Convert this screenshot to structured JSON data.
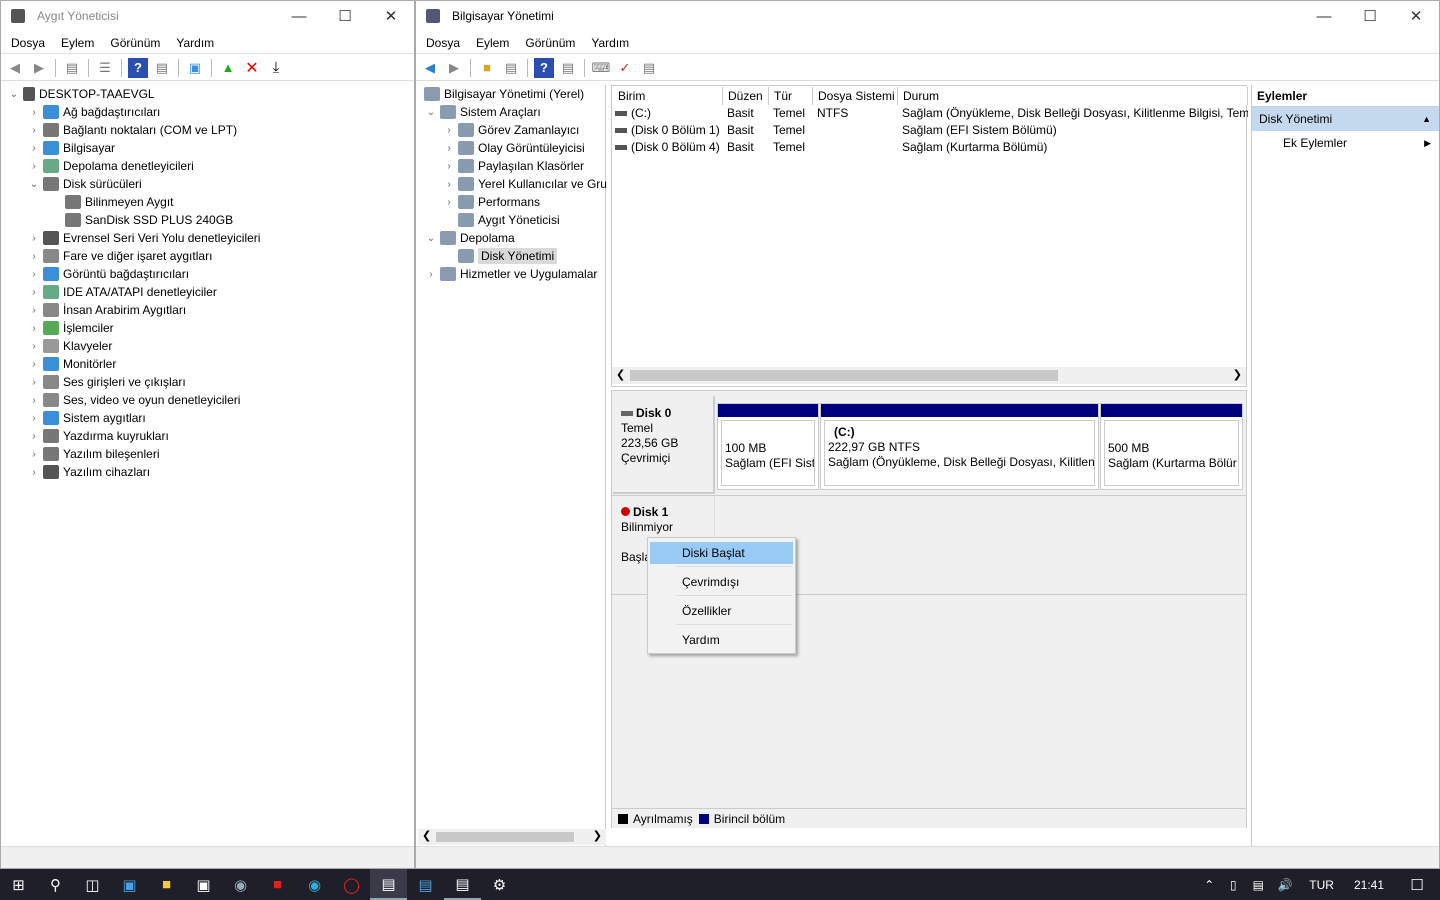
{
  "device_manager": {
    "title": "Aygıt Yöneticisi",
    "menu": [
      "Dosya",
      "Eylem",
      "Görünüm",
      "Yardım"
    ],
    "root": "DESKTOP-TAAEVGL",
    "items": [
      {
        "label": "Ağ bağdaştırıcıları",
        "level": 1,
        "state": "collapsed",
        "icon": "network-adapter-icon",
        "color": "#3a8fd8"
      },
      {
        "label": "Bağlantı noktaları (COM ve LPT)",
        "level": 1,
        "state": "collapsed",
        "icon": "port-icon",
        "color": "#777"
      },
      {
        "label": "Bilgisayar",
        "level": 1,
        "state": "collapsed",
        "icon": "computer-icon",
        "color": "#3a8fd8"
      },
      {
        "label": "Depolama denetleyicileri",
        "level": 1,
        "state": "collapsed",
        "icon": "storage-controller-icon",
        "color": "#6a8"
      },
      {
        "label": "Disk sürücüleri",
        "level": 1,
        "state": "expanded",
        "icon": "disk-drive-icon",
        "color": "#777"
      },
      {
        "label": "Bilinmeyen Aygıt",
        "level": 2,
        "state": "none",
        "icon": "disk-drive-icon",
        "color": "#777"
      },
      {
        "label": "SanDisk SSD PLUS 240GB",
        "level": 2,
        "state": "none",
        "icon": "disk-drive-icon",
        "color": "#777"
      },
      {
        "label": "Evrensel Seri Veri Yolu denetleyicileri",
        "level": 1,
        "state": "collapsed",
        "icon": "usb-icon",
        "color": "#555"
      },
      {
        "label": "Fare ve diğer işaret aygıtları",
        "level": 1,
        "state": "collapsed",
        "icon": "mouse-icon",
        "color": "#888"
      },
      {
        "label": "Görüntü bağdaştırıcıları",
        "level": 1,
        "state": "collapsed",
        "icon": "display-adapter-icon",
        "color": "#3a8fd8"
      },
      {
        "label": "IDE ATA/ATAPI denetleyiciler",
        "level": 1,
        "state": "collapsed",
        "icon": "ide-icon",
        "color": "#6a8"
      },
      {
        "label": "İnsan Arabirim Aygıtları",
        "level": 1,
        "state": "collapsed",
        "icon": "hid-icon",
        "color": "#888"
      },
      {
        "label": "İşlemciler",
        "level": 1,
        "state": "collapsed",
        "icon": "processor-icon",
        "color": "#5a5"
      },
      {
        "label": "Klavyeler",
        "level": 1,
        "state": "collapsed",
        "icon": "keyboard-icon",
        "color": "#999"
      },
      {
        "label": "Monitörler",
        "level": 1,
        "state": "collapsed",
        "icon": "monitor-icon",
        "color": "#3a8fd8"
      },
      {
        "label": "Ses girişleri ve çıkışları",
        "level": 1,
        "state": "collapsed",
        "icon": "speaker-icon",
        "color": "#888"
      },
      {
        "label": "Ses, video ve oyun denetleyicileri",
        "level": 1,
        "state": "collapsed",
        "icon": "sound-icon",
        "color": "#888"
      },
      {
        "label": "Sistem aygıtları",
        "level": 1,
        "state": "collapsed",
        "icon": "system-devices-icon",
        "color": "#3a8fd8"
      },
      {
        "label": "Yazdırma kuyrukları",
        "level": 1,
        "state": "collapsed",
        "icon": "printer-icon",
        "color": "#777"
      },
      {
        "label": "Yazılım bileşenleri",
        "level": 1,
        "state": "collapsed",
        "icon": "software-component-icon",
        "color": "#777"
      },
      {
        "label": "Yazılım cihazları",
        "level": 1,
        "state": "collapsed",
        "icon": "software-device-icon",
        "color": "#555"
      }
    ]
  },
  "computer_management": {
    "title": "Bilgisayar Yönetimi",
    "menu": [
      "Dosya",
      "Eylem",
      "Görünüm",
      "Yardım"
    ],
    "tree": [
      {
        "label": "Bilgisayar Yönetimi (Yerel)",
        "level": 0,
        "state": "none",
        "icon": "computer-management-icon"
      },
      {
        "label": "Sistem Araçları",
        "level": 1,
        "state": "expanded",
        "icon": "tools-icon"
      },
      {
        "label": "Görev Zamanlayıcı",
        "level": 2,
        "state": "collapsed",
        "icon": "clock-icon"
      },
      {
        "label": "Olay Görüntüleyicisi",
        "level": 2,
        "state": "collapsed",
        "icon": "event-viewer-icon"
      },
      {
        "label": "Paylaşılan Klasörler",
        "level": 2,
        "state": "collapsed",
        "icon": "shared-folder-icon"
      },
      {
        "label": "Yerel Kullanıcılar ve Gru",
        "level": 2,
        "state": "collapsed",
        "icon": "users-icon"
      },
      {
        "label": "Performans",
        "level": 2,
        "state": "collapsed",
        "icon": "performance-icon"
      },
      {
        "label": "Aygıt Yöneticisi",
        "level": 2,
        "state": "none",
        "icon": "device-manager-icon"
      },
      {
        "label": "Depolama",
        "level": 1,
        "state": "expanded",
        "icon": "storage-icon"
      },
      {
        "label": "Disk Yönetimi",
        "level": 2,
        "state": "selected",
        "icon": "disk-management-icon"
      },
      {
        "label": "Hizmetler ve Uygulamalar",
        "level": 1,
        "state": "collapsed",
        "icon": "services-icon"
      }
    ],
    "volume_table": {
      "headers": [
        "Birim",
        "Düzen",
        "Tür",
        "Dosya Sistemi",
        "Durum"
      ],
      "rows": [
        [
          "(C:)",
          "Basit",
          "Temel",
          "NTFS",
          "Sağlam (Önyükleme, Disk Belleği Dosyası, Kilitlenme Bilgisi, Teme"
        ],
        [
          "(Disk 0 Bölüm 1)",
          "Basit",
          "Temel",
          "",
          "Sağlam (EFI Sistem Bölümü)"
        ],
        [
          "(Disk 0 Bölüm 4)",
          "Basit",
          "Temel",
          "",
          "Sağlam (Kurtarma Bölümü)"
        ]
      ]
    },
    "disks": [
      {
        "name": "Disk 0",
        "type": "Temel",
        "size": "223,56 GB",
        "status": "Çevrimiçi",
        "partitions": [
          {
            "label": "",
            "size": "100 MB",
            "status": "Sağlam (EFI Siste"
          },
          {
            "label": "(C:)",
            "size": "222,97 GB NTFS",
            "status": "Sağlam (Önyükleme, Disk Belleği Dosyası, Kilitlenn"
          },
          {
            "label": "",
            "size": "500 MB",
            "status": "Sağlam (Kurtarma Bölür"
          }
        ]
      },
      {
        "name": "Disk 1",
        "type": "Bilinmiyor",
        "status": "Başla"
      }
    ],
    "context_menu": [
      "Diski Başlat",
      "Çevrimdışı",
      "Özellikler",
      "Yardım"
    ],
    "legend": [
      {
        "label": "Ayrılmamış",
        "color": "#000000"
      },
      {
        "label": "Birincil bölüm",
        "color": "#00007f"
      }
    ],
    "actions": {
      "header": "Eylemler",
      "section": "Disk Yönetimi",
      "more": "Ek Eylemler"
    }
  },
  "taskbar": {
    "language": "TUR",
    "time": "21:41"
  },
  "colors": {
    "partition_bar": "#00007f",
    "selection": "#99c9f5",
    "taskbar": "#1f1f2a"
  }
}
